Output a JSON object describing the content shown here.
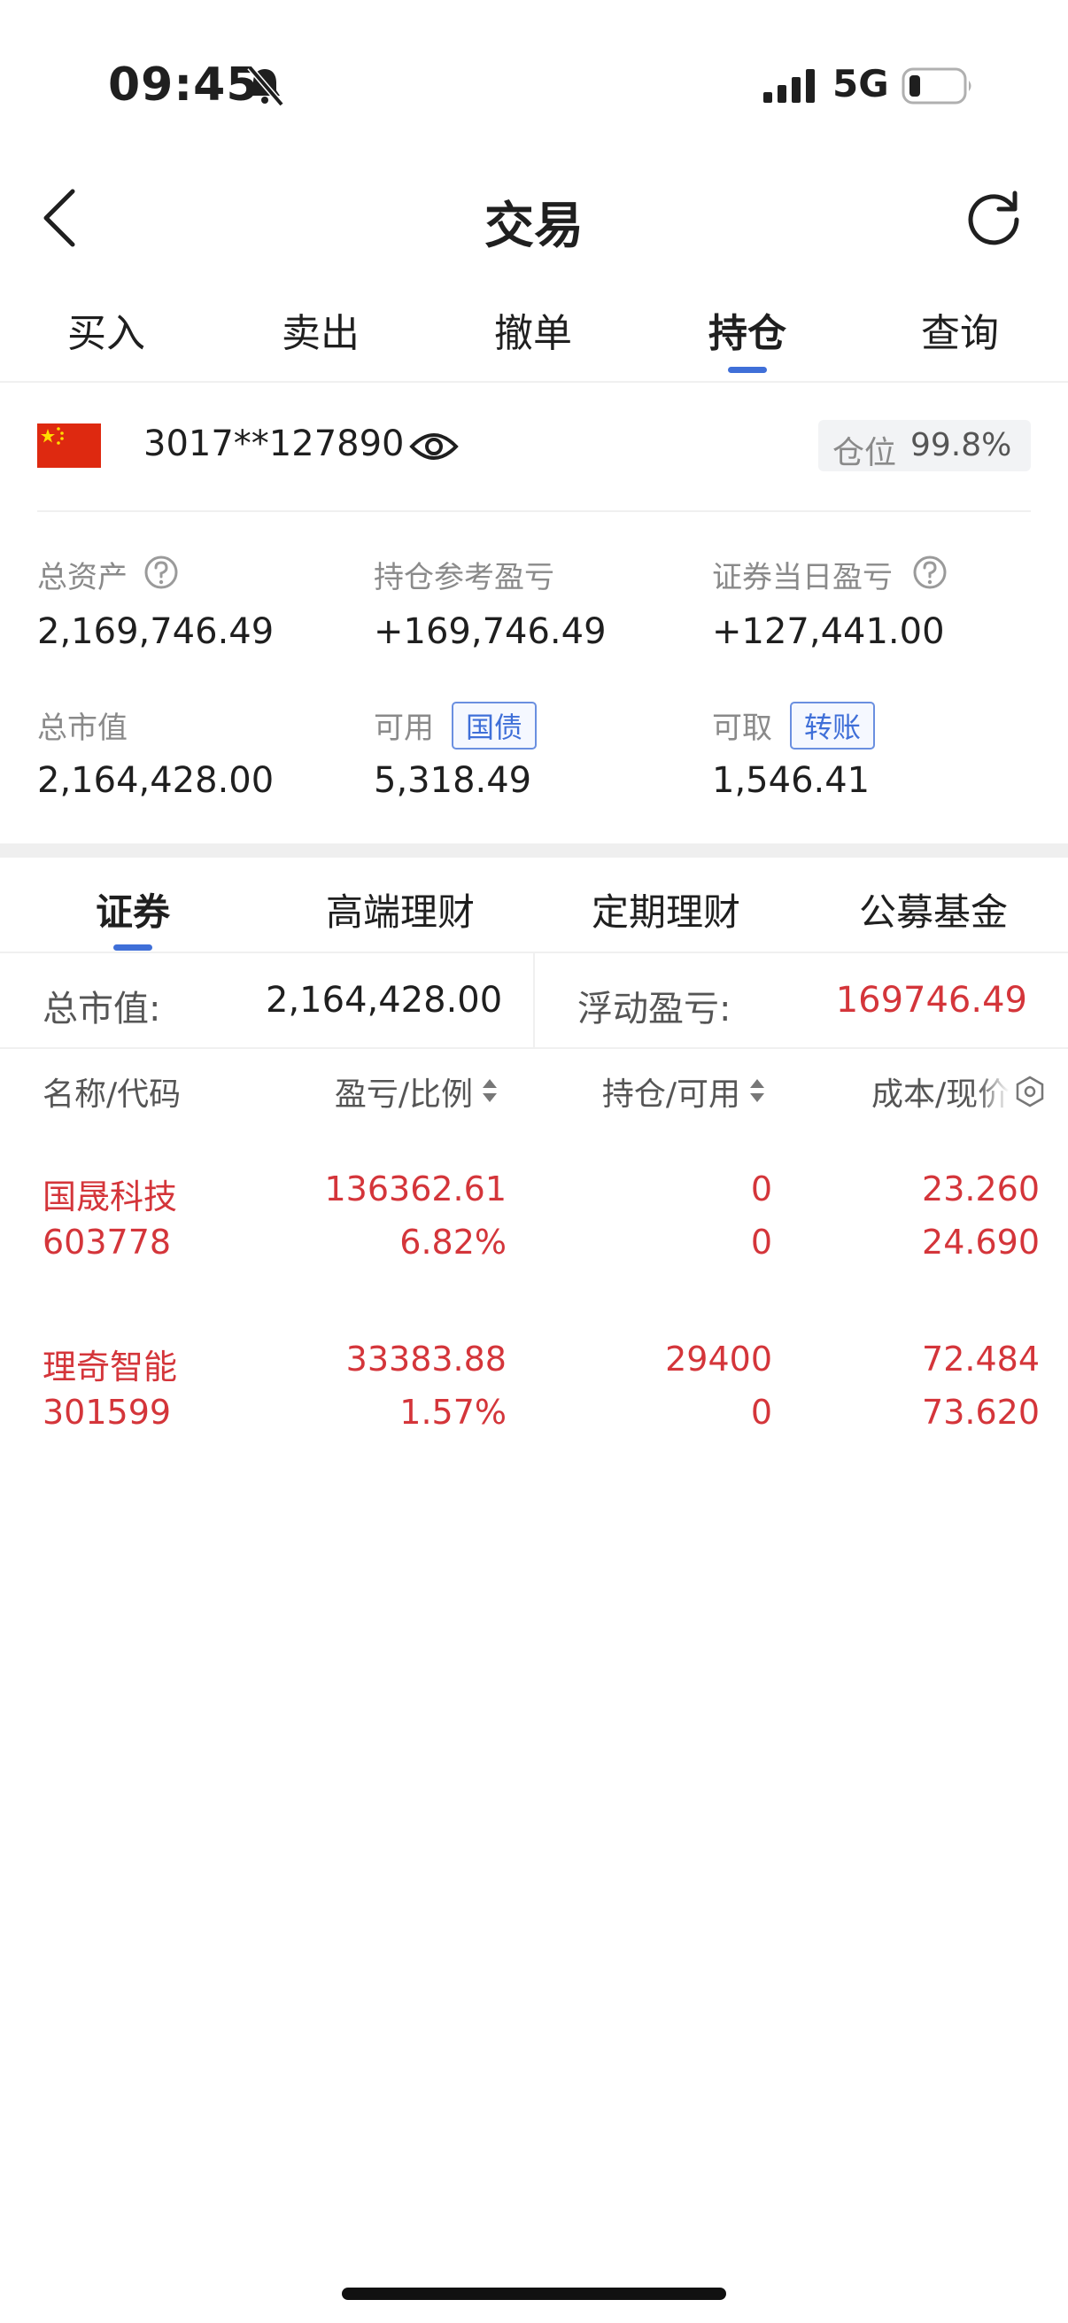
{
  "status_bar": {
    "time": "09:45",
    "network": "5G"
  },
  "header": {
    "title": "交易"
  },
  "trade_tabs": [
    {
      "label": "买入"
    },
    {
      "label": "卖出"
    },
    {
      "label": "撤单"
    },
    {
      "label": "持仓",
      "active": true
    },
    {
      "label": "查询"
    }
  ],
  "account": {
    "number": "3017**127890",
    "position_label": "仓位",
    "position_value": "99.8%"
  },
  "assets": {
    "total_assets_label": "总资产",
    "total_assets": "2,169,746.49",
    "position_pnl_label": "持仓参考盈亏",
    "position_pnl": "+169,746.49",
    "daily_pnl_label": "证券当日盈亏",
    "daily_pnl": "+127,441.00",
    "market_value_label": "总市值",
    "market_value": "2,164,428.00",
    "available_label": "可用",
    "available_tag": "国债",
    "available": "5,318.49",
    "withdrawable_label": "可取",
    "withdrawable_tag": "转账",
    "withdrawable": "1,546.41"
  },
  "product_tabs": [
    {
      "label": "证券",
      "active": true
    },
    {
      "label": "高端理财"
    },
    {
      "label": "定期理财"
    },
    {
      "label": "公募基金"
    }
  ],
  "totals": {
    "market_value_label": "总市值:",
    "market_value": "2,164,428.00",
    "floating_pnl_label": "浮动盈亏:",
    "floating_pnl": "169746.49"
  },
  "table": {
    "headers": [
      "名称/代码",
      "盈亏/比例",
      "持仓/可用",
      "成本/现价"
    ],
    "rows": [
      {
        "name": "国晟科技",
        "code": "603778",
        "pnl": "136362.61",
        "ratio": "6.82%",
        "position": "0",
        "available": "0",
        "cost": "23.260",
        "price": "24.690"
      },
      {
        "name": "理奇智能",
        "code": "301599",
        "pnl": "33383.88",
        "ratio": "1.57%",
        "position": "29400",
        "available": "0",
        "cost": "72.484",
        "price": "73.620"
      }
    ]
  },
  "colors": {
    "accent": "#3f6fd8",
    "gain": "#d4353a",
    "text": "#1f1f1f",
    "muted": "#8a8a8a"
  }
}
